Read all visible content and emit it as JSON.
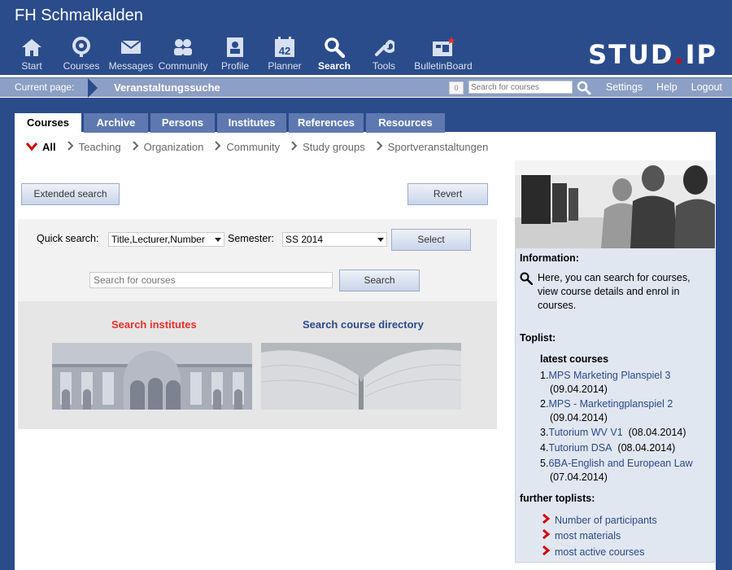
{
  "header": {
    "site_title": "FH Schmalkalden",
    "logo_left": "STUD",
    "logo_dot": ".",
    "logo_right": "IP",
    "nav": [
      {
        "label": "Start",
        "icon": "home-icon"
      },
      {
        "label": "Courses",
        "icon": "courses-icon"
      },
      {
        "label": "Messages",
        "icon": "mail-icon"
      },
      {
        "label": "Community",
        "icon": "people-icon"
      },
      {
        "label": "Profile",
        "icon": "profile-icon"
      },
      {
        "label": "Planner",
        "icon": "calendar-icon",
        "calendar_day": "42"
      },
      {
        "label": "Search",
        "icon": "search-icon",
        "active": true
      },
      {
        "label": "Tools",
        "icon": "wrench-icon"
      },
      {
        "label": "BulletinBoard",
        "icon": "bulletin-icon"
      }
    ]
  },
  "subbar": {
    "current_label": "Current page:",
    "current_page": "Veranstaltungssuche",
    "count": "0",
    "search_placeholder": "Search for courses",
    "links": [
      "Settings",
      "Help",
      "Logout"
    ]
  },
  "tabs": [
    "Courses",
    "Archive",
    "Persons",
    "Institutes",
    "References",
    "Resources"
  ],
  "subnav": [
    "All",
    "Teaching",
    "Organization",
    "Community",
    "Study groups",
    "Sportveranstaltungen"
  ],
  "main": {
    "extended_search": "Extended search",
    "revert": "Revert",
    "quick_search_label": "Quick search:",
    "quick_search_value": "Title,Lecturer,Number",
    "semester_label": "Semester:",
    "semester_value": "SS 2014",
    "select_button": "Select",
    "course_input_placeholder": "Search for courses",
    "search_button": "Search",
    "search_institutes": "Search institutes",
    "search_directory": "Search course directory"
  },
  "sidebar": {
    "info_title": "Information:",
    "info_text": "Here, you can search for courses, view course details and enrol in courses.",
    "toplist_title": "Toplist:",
    "latest_title": "latest courses",
    "latest": [
      {
        "num": "1.",
        "title": "MPS Marketing Planspiel 3",
        "date": "(09.04.2014)"
      },
      {
        "num": "2.",
        "title": "MPS - Marketingplanspiel 2",
        "date": "(09.04.2014)"
      },
      {
        "num": "3.",
        "title": "Tutorium WV V1",
        "date": "(08.04.2014)"
      },
      {
        "num": "4.",
        "title": "Tutorium DSA",
        "date": "(08.04.2014)"
      },
      {
        "num": "5.",
        "title": "6BA-English and European Law",
        "date": "(07.04.2014)"
      }
    ],
    "further_title": "further toplists:",
    "further": [
      "Number of participants",
      "most materials",
      "most active courses"
    ]
  },
  "colors": {
    "header_bg": "#2b4c8b",
    "subbar_bg": "#8c9fc4",
    "tab_bg": "#5e79b0",
    "link_red": "#e8302a",
    "link_blue": "#2a4a8a",
    "sidebar_bg": "#e1e7f1"
  }
}
